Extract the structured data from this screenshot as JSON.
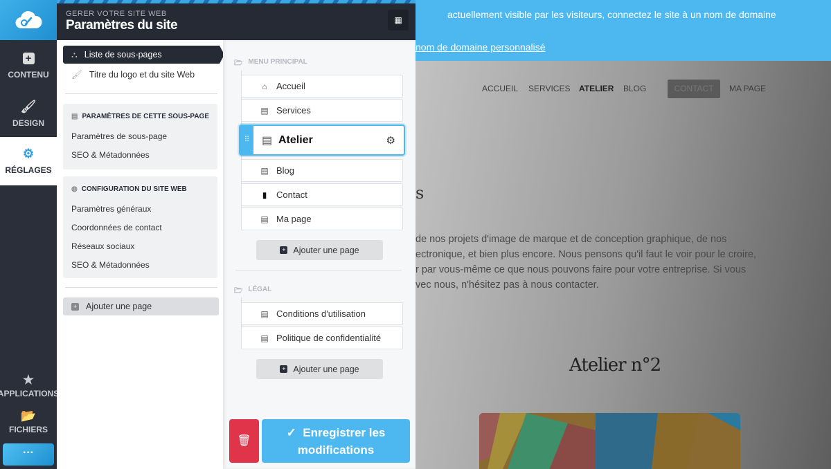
{
  "rail": {
    "items": [
      {
        "label": "CONTENU",
        "icon": "plus-square-icon"
      },
      {
        "label": "DESIGN",
        "icon": "brush-icon"
      },
      {
        "label": "RÉGLAGES",
        "icon": "gears-icon",
        "active": true
      },
      {
        "label": "APPLICATIONS",
        "icon": "star-icon"
      },
      {
        "label": "FICHIERS",
        "icon": "folder-icon"
      }
    ],
    "more": "···"
  },
  "header": {
    "kicker": "GERER VOTRE SITE WEB",
    "title": "Paramètres du site"
  },
  "left_panel": {
    "nav": [
      {
        "label": "Liste de sous-pages",
        "active": true
      },
      {
        "label": "Titre du logo et du site Web"
      }
    ],
    "box1": {
      "title": "PARAMÈTRES DE CETTE SOUS-PAGE",
      "items": [
        "Paramètres de sous-page",
        "SEO & Métadonnées"
      ]
    },
    "box2": {
      "title": "CONFIGURATION DU SITE WEB",
      "items": [
        "Paramètres généraux",
        "Coordonnées de contact",
        "Réseaux sociaux",
        "SEO & Métadonnées"
      ]
    },
    "add": "Ajouter une page"
  },
  "pages": {
    "menu_title": "MENU PRINCIPAL",
    "menu": [
      "Accueil",
      "Services",
      "Atelier",
      "Blog",
      "Contact",
      "Ma page"
    ],
    "selected": "Atelier",
    "add": "Ajouter une page",
    "legal_title": "LÉGAL",
    "legal": [
      "Conditions d'utilisation",
      "Politique de confidentialité"
    ],
    "save": "Enregistrer les modifications"
  },
  "preview": {
    "banner_text": "actuellement visible par les visiteurs, connectez le site à un nom de domaine",
    "banner_link": "nom de domaine personnalisé",
    "nav": [
      "ACCUEIL",
      "SERVICES",
      "ATELIER",
      "BLOG",
      "CONTACT",
      "MA PAGE"
    ],
    "heading_fragment": "s",
    "paragraph": [
      "de nos projets d'image de marque et de conception graphique, de nos",
      "ectronique, et bien plus encore. Nous pensons qu'il faut le voir pour le croire,",
      "r par vous-même ce que nous pouvons faire pour votre entreprise. Si vous",
      "vec nous, n'hésitez pas à nous contacter."
    ],
    "section_title": "Atelier n°2"
  },
  "colors": {
    "accent": "#4db8f0",
    "dark": "#252a35",
    "danger": "#e0344a"
  }
}
